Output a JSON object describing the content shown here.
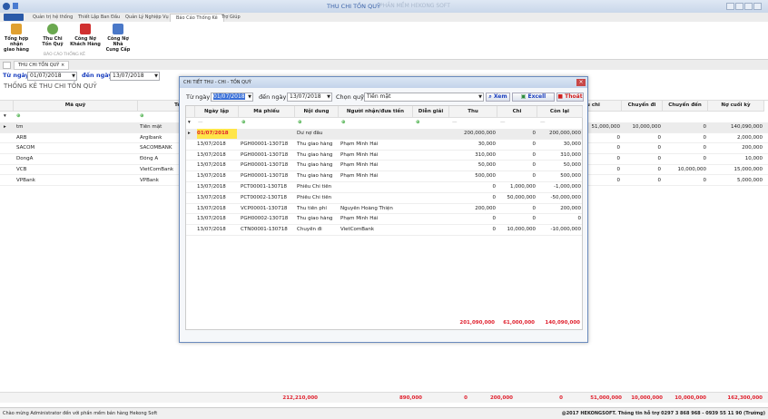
{
  "window": {
    "title": "THU CHI TỒN QUỸ",
    "subtitle": "PHẦN MỀM HEKONG SOFT"
  },
  "menu": [
    "Quản trị hệ thống",
    "Thiết Lập Ban Đầu",
    "Quản Lý Nghiệp Vụ",
    "Báo Cáo Thống Kê",
    "Trợ Giúp"
  ],
  "ribbon": {
    "buttons": [
      {
        "l1": "Tổng hợp nhận",
        "l2": "giao hàng",
        "icon": "sigma-icon",
        "color": "#e0a030"
      },
      {
        "l1": "Thu Chi",
        "l2": "Tồn Quỹ",
        "icon": "coins-icon",
        "color": "#6aa84f"
      },
      {
        "l1": "Công Nợ",
        "l2": "Khách Hàng",
        "icon": "customer-debt-icon",
        "color": "#d03030"
      },
      {
        "l1": "Công Nợ Nhà",
        "l2": "Cung Cấp",
        "icon": "supplier-debt-icon",
        "color": "#4a78c8"
      }
    ],
    "group": "BÁO CÁO THỐNG KÊ"
  },
  "doctab": "THU CHI TỒN QUỸ",
  "filter": {
    "from_label": "Từ ngày",
    "from": "01/07/2018",
    "to_label": "đến ngày",
    "to": "13/07/2018"
  },
  "heading": "THỐNG KÊ THU CHI TỒN QUỸ",
  "main_grid": {
    "headers": [
      "Mã quỹ",
      "Tê",
      "u chi",
      "Chuyển đi",
      "Chuyển đến",
      "Nợ cuối kỳ"
    ],
    "rows": [
      [
        "tm",
        "Tiền mặt",
        "51,000,000",
        "10,000,000",
        "0",
        "140,090,000"
      ],
      [
        "ARB",
        "Argibank",
        "0",
        "0",
        "0",
        "2,000,000"
      ],
      [
        "SACOM",
        "SACOMBANK",
        "0",
        "0",
        "0",
        "200,000"
      ],
      [
        "DongA",
        "Đông Á",
        "0",
        "0",
        "0",
        "10,000"
      ],
      [
        "VCB",
        "VietComBank",
        "0",
        "0",
        "10,000,000",
        "15,000,000"
      ],
      [
        "VPBank",
        "VPBank",
        "0",
        "0",
        "0",
        "5,000,000"
      ]
    ],
    "totals": [
      "212,210,000",
      "890,000",
      "0",
      "200,000",
      "0",
      "51,000,000",
      "10,000,000",
      "10,000,000",
      "162,300,000"
    ]
  },
  "dialog": {
    "title": "CHI TIẾT THU - CHI - TỒN QUỸ",
    "from_label": "Từ ngày",
    "from": "01/07/2018",
    "to_label": "đến ngày",
    "to": "13/07/2018",
    "fund_label": "Chọn quỹ",
    "fund": "Tiền mặt",
    "view": "Xem",
    "excel": "Excell",
    "exit": "Thoát",
    "headers": [
      "Ngày lập",
      "Mã phiếu",
      "Nội dung",
      "Người nhận/đưa tiền",
      "Diễn giải",
      "Thu",
      "Chi",
      "Còn lại"
    ],
    "rows": [
      [
        "01/07/2018",
        "",
        "Dư nợ đầu",
        "",
        "",
        "200,000,000",
        "0",
        "200,000,000"
      ],
      [
        "13/07/2018",
        "PGH00001-130718",
        "Thu giao hàng",
        "Phạm Minh Hải",
        "",
        "30,000",
        "0",
        "30,000"
      ],
      [
        "13/07/2018",
        "PGH00001-130718",
        "Thu giao hàng",
        "Phạm Minh Hải",
        "",
        "310,000",
        "0",
        "310,000"
      ],
      [
        "13/07/2018",
        "PGH00001-130718",
        "Thu giao hàng",
        "Phạm Minh Hải",
        "",
        "50,000",
        "0",
        "50,000"
      ],
      [
        "13/07/2018",
        "PGH00001-130718",
        "Thu giao hàng",
        "Phạm Minh Hải",
        "",
        "500,000",
        "0",
        "500,000"
      ],
      [
        "13/07/2018",
        "PCT00001-130718",
        "Phiếu Chi tiền",
        "",
        "",
        "0",
        "1,000,000",
        "-1,000,000"
      ],
      [
        "13/07/2018",
        "PCT00002-130718",
        "Phiếu Chi tiền",
        "",
        "",
        "0",
        "50,000,000",
        "-50,000,000"
      ],
      [
        "13/07/2018",
        "VCP00001-130718",
        "Thu tiền phí",
        "Nguyễn Hoàng Thiện",
        "",
        "200,000",
        "0",
        "200,000"
      ],
      [
        "13/07/2018",
        "PGH00002-130718",
        "Thu giao hàng",
        "Phạm Minh Hải",
        "",
        "0",
        "0",
        "0"
      ],
      [
        "13/07/2018",
        "CTN00001-130718",
        "Chuyển đi",
        "VietComBank",
        "",
        "0",
        "10,000,000",
        "-10,000,000"
      ]
    ],
    "totals": [
      "201,090,000",
      "61,000,000",
      "140,090,000"
    ]
  },
  "status": {
    "left": "Chào mừng Administrator đến với phần mềm bán hàng Hekong Soft",
    "right": "@2017 HEKONGSOFT. Thông tin hỗ trợ 0297 3 868 968 - 0939 55 11 90 (Trường)"
  }
}
